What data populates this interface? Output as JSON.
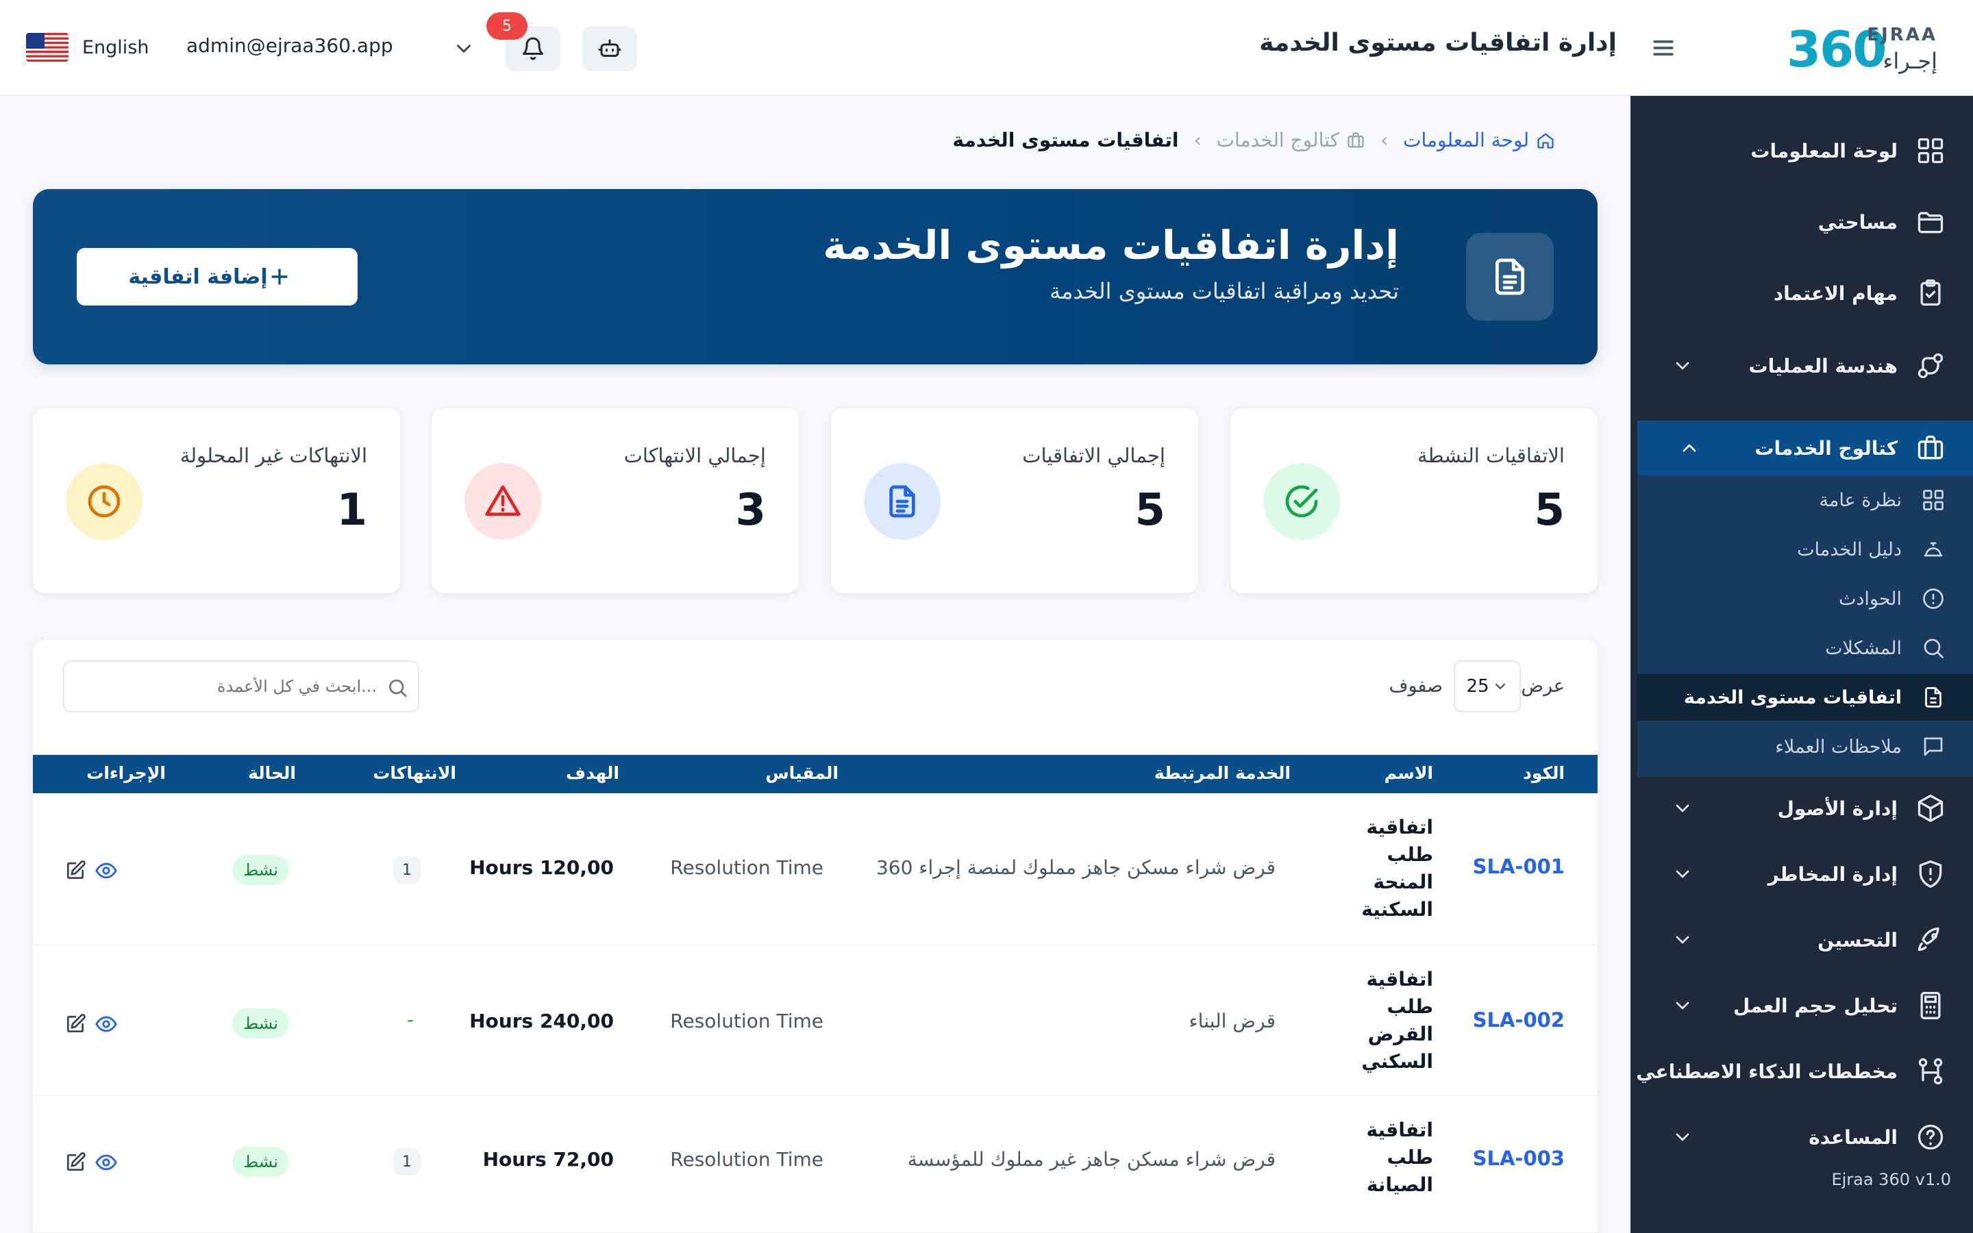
{
  "topbar": {
    "language": "English",
    "user_email": "admin@ejraa360.app",
    "notifications_count": "5",
    "page_title": "إدارة اتفاقيات مستوى الخدمة",
    "logo_number": "360",
    "logo_en": "EJRAA",
    "logo_ar": "إجـراء"
  },
  "sidebar": {
    "items": [
      {
        "label": "لوحة المعلومات",
        "icon": "dashboard-icon"
      },
      {
        "label": "مساحتي",
        "icon": "folder-icon"
      },
      {
        "label": "مهام الاعتماد",
        "icon": "clipboard-check-icon"
      },
      {
        "label": "هندسة العمليات",
        "icon": "workflow-icon"
      },
      {
        "label": "كتالوج الخدمات",
        "icon": "briefcase-icon"
      },
      {
        "label": "إدارة الأصول",
        "icon": "box-icon"
      },
      {
        "label": "إدارة المخاطر",
        "icon": "shield-alert-icon"
      },
      {
        "label": "التحسين",
        "icon": "rocket-icon"
      },
      {
        "label": "تحليل حجم العمل",
        "icon": "calculator-icon"
      },
      {
        "label": "مخططات الذكاء الاصطناعي",
        "icon": "ai-workflow-icon"
      },
      {
        "label": "المساعدة",
        "icon": "help-icon"
      }
    ],
    "submenu": [
      {
        "label": "نظرة عامة",
        "icon": "grid-icon"
      },
      {
        "label": "دليل الخدمات",
        "icon": "service-bell-icon"
      },
      {
        "label": "الحوادث",
        "icon": "alert-circle-icon"
      },
      {
        "label": "المشكلات",
        "icon": "search-icon"
      },
      {
        "label": "اتفاقيات مستوى الخدمة",
        "icon": "document-icon"
      },
      {
        "label": "ملاحظات العملاء",
        "icon": "message-icon"
      }
    ],
    "version": "Ejraa 360 v1.0"
  },
  "breadcrumb": {
    "home": "لوحة المعلومات",
    "catalog": "كتالوج الخدمات",
    "current": "اتفاقيات مستوى الخدمة"
  },
  "hero": {
    "title": "إدارة اتفاقيات مستوى الخدمة",
    "subtitle": "تحديد ومراقبة اتفاقيات مستوى الخدمة",
    "add_button": "إضافة اتفاقية"
  },
  "stats": [
    {
      "label": "الاتفاقيات النشطة",
      "value": "5",
      "color": "#16a34a",
      "bg": "#dcfce7"
    },
    {
      "label": "إجمالي الاتفاقيات",
      "value": "5",
      "color": "#2563eb",
      "bg": "#dbeafe"
    },
    {
      "label": "إجمالي الانتهاكات",
      "value": "3",
      "color": "#dc2626",
      "bg": "#fee2e2"
    },
    {
      "label": "الانتهاكات غير المحلولة",
      "value": "1",
      "color": "#d97706",
      "bg": "#fef3c7"
    }
  ],
  "table": {
    "show_label": "عرض",
    "rows_value": "25",
    "rows_label": "صفوف",
    "search_placeholder": "ابحث في كل الأعمدة...",
    "headers": {
      "code": "الكود",
      "name": "الاسم",
      "service": "الخدمة المرتبطة",
      "metric": "المقياس",
      "target": "الهدف",
      "violations": "الانتهاكات",
      "status": "الحالة",
      "actions": "الإجراءات"
    },
    "rows": [
      {
        "code": "SLA-001",
        "name": "اتفاقية طلب المنحة السكنية",
        "service": "قرض شراء مسكن جاهز مملوك لمنصة إجراء 360",
        "metric": "Resolution Time",
        "target": "Hours 120,00",
        "violations": "1",
        "status": "نشط"
      },
      {
        "code": "SLA-002",
        "name": "اتفاقية طلب القرض السكني",
        "service": "قرض البناء",
        "metric": "Resolution Time",
        "target": "Hours 240,00",
        "violations": "-",
        "status": "نشط"
      },
      {
        "code": "SLA-003",
        "name": "اتفاقية طلب الصيانة",
        "service": "قرض شراء مسكن جاهز غير مملوك للمؤسسة",
        "metric": "Resolution Time",
        "target": "Hours 72,00",
        "violations": "1",
        "status": "نشط"
      }
    ]
  }
}
